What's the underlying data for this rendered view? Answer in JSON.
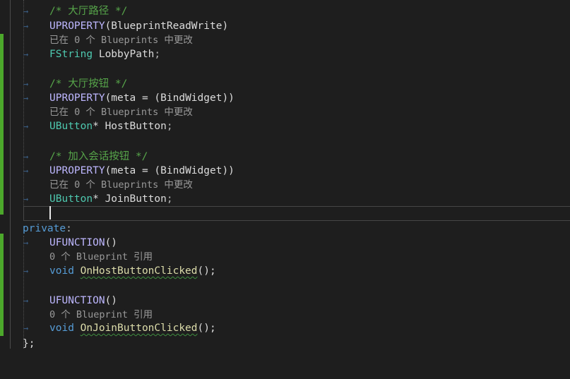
{
  "editor": {
    "tab_arrow": "→",
    "blocks": [
      {
        "comment": "/* 大厅路径 */",
        "macro": "UPROPERTY",
        "macro_args": "(BlueprintReadWrite)",
        "lens": "已在 0 个 Blueprints 中更改",
        "type": "FString",
        "name": "LobbyPath",
        "end": ";"
      },
      {
        "comment": "/* 大厅按钮 */",
        "macro": "UPROPERTY",
        "macro_args": "(meta = (BindWidget))",
        "lens": "已在 0 个 Blueprints 中更改",
        "type": "UButton",
        "pointer": "*",
        "name": "HostButton",
        "end": ";"
      },
      {
        "comment": "/* 加入会话按钮 */",
        "macro": "UPROPERTY",
        "macro_args": "(meta = (BindWidget))",
        "lens": "已在 0 个 Blueprints 中更改",
        "type": "UButton",
        "pointer": "*",
        "name": "JoinButton",
        "end": ";"
      }
    ],
    "access_specifier": "private",
    "access_colon": ":",
    "functions": [
      {
        "macro": "UFUNCTION",
        "macro_args": "()",
        "lens": "0 个 Blueprint 引用",
        "return_type": "void",
        "name": "OnHostButtonClicked",
        "args": "();"
      },
      {
        "macro": "UFUNCTION",
        "macro_args": "()",
        "lens": "0 个 Blueprint 引用",
        "return_type": "void",
        "name": "OnJoinButtonClicked",
        "args": "();"
      }
    ],
    "closing": "};"
  }
}
